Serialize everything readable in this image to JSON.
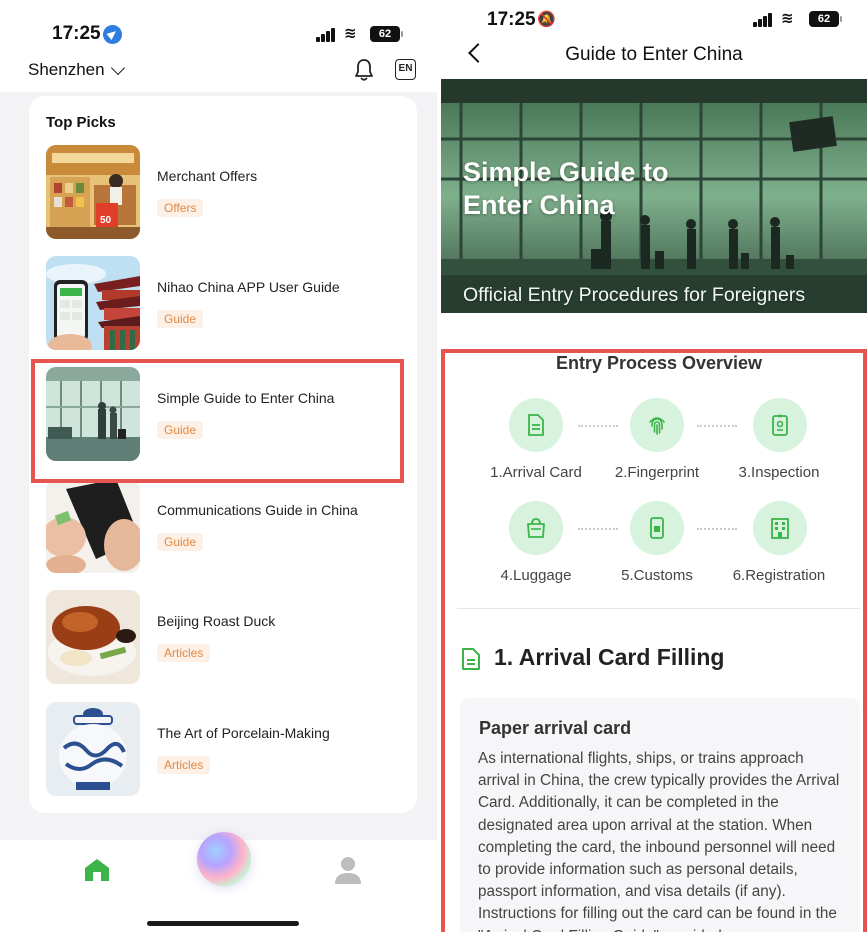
{
  "left_screen": {
    "status": {
      "time": "17:25",
      "battery": "62"
    },
    "header": {
      "city": "Shenzhen",
      "language_button": "EN"
    },
    "top_picks": {
      "title": "Top Picks",
      "items": [
        {
          "title": "Merchant Offers",
          "tag": "Offers",
          "thumbnail": "store-counter-photo"
        },
        {
          "title": "Nihao China APP User Guide",
          "tag": "Guide",
          "thumbnail": "phone-pagoda-photo"
        },
        {
          "title": "Simple Guide to Enter China",
          "tag": "Guide",
          "thumbnail": "airport-terminal-photo",
          "highlighted": true
        },
        {
          "title": "Communications Guide in China",
          "tag": "Guide",
          "thumbnail": "phone-sim-card-photo"
        },
        {
          "title": "Beijing Roast Duck",
          "tag": "Articles",
          "thumbnail": "roast-duck-photo"
        },
        {
          "title": "The Art of Porcelain-Making",
          "tag": "Articles",
          "thumbnail": "porcelain-jar-photo"
        }
      ]
    },
    "tabbar": {
      "icons": [
        "home-icon",
        "assistant-orb",
        "profile-icon"
      ]
    }
  },
  "right_screen": {
    "status": {
      "time": "17:25",
      "battery": "62"
    },
    "nav": {
      "title": "Guide to Enter China"
    },
    "hero": {
      "title": "Simple Guide to Enter China",
      "subtitle": "Official Entry Procedures for Foreigners"
    },
    "overview": {
      "title": "Entry Process Overview",
      "steps": [
        {
          "label": "1.Arrival Card",
          "icon": "document-icon"
        },
        {
          "label": "2.Fingerprint",
          "icon": "fingerprint-icon"
        },
        {
          "label": "3.Inspection",
          "icon": "id-badge-icon"
        },
        {
          "label": "4.Luggage",
          "icon": "bag-icon"
        },
        {
          "label": "5.Customs",
          "icon": "phone-card-icon"
        },
        {
          "label": "6.Registration",
          "icon": "building-icon"
        }
      ]
    },
    "section1": {
      "heading": "1. Arrival Card Filling",
      "box_title": "Paper arrival card",
      "box_text": "As international flights, ships, or trains approach arrival in China, the crew typically provides the Arrival Card. Additionally, it can be completed in the designated area upon arrival at the station. When completing the card, the inbound personnel will need to provide information such as personal details, passport information, and visa details (if any). Instructions for filling out the card can be found in the \"Arrival Card Filling Guide\" provided"
    }
  },
  "colors": {
    "accent_green": "#3bb54a",
    "step_circle": "#d7f3dd",
    "tag_bg": "#fdf0e6",
    "tag_text": "#e08a44",
    "highlight": "#e85550"
  }
}
